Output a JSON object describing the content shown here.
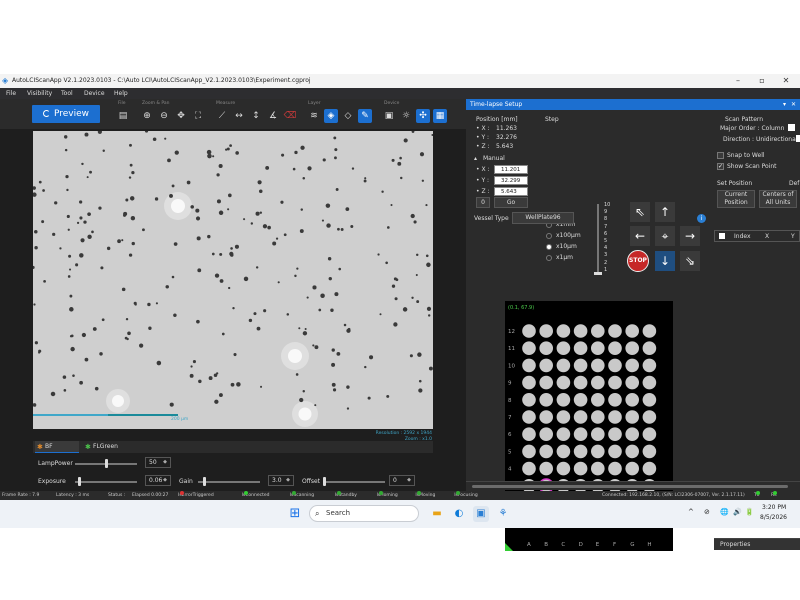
{
  "window": {
    "title": "AutoLCIScanApp V2.1.2023.0103 - C:\\Auto LCI\\AutoLCIScanApp_V2.1.2023.0103\\Experiment.cgproj",
    "minimize": "–",
    "maximize": "▫",
    "close": "✕"
  },
  "menu": [
    "File",
    "Visibility",
    "Tool",
    "Device",
    "Help"
  ],
  "toolbar": {
    "preview_label": "Preview",
    "groups": [
      "File",
      "Zoom & Pan",
      "Measure",
      "Layer",
      "Device"
    ]
  },
  "viewer": {
    "resolution": "Resolution : 2592 x 1944",
    "zoom": "Zoom : x1.0",
    "scalebar": "200 µm"
  },
  "channels": [
    {
      "label": "BF",
      "color": "#e08a2b",
      "selected": true
    },
    {
      "label": "FLGreen",
      "color": "#4cc24c",
      "selected": false
    }
  ],
  "controls": {
    "lamp_power": {
      "label": "LampPower",
      "value": "50"
    },
    "exposure": {
      "label": "Exposure",
      "value": "0.06"
    },
    "gain": {
      "label": "Gain",
      "value": "3.0"
    },
    "offset": {
      "label": "Offset",
      "value": "0"
    }
  },
  "panel": {
    "title": "Time-lapse Setup",
    "pin": "▾",
    "close": "✕",
    "position": {
      "heading": "Position [mm]",
      "x_label": "• X :",
      "x": "11.263",
      "y_label": "• Y :",
      "y": "32.276",
      "z_label": "• Z :",
      "z": "5.643",
      "manual_label": "Manual",
      "mx": "11.201",
      "my": "32.299",
      "mz": "5.643",
      "zero_label": "0",
      "go_label": "Go"
    },
    "step": {
      "heading": "Step",
      "options": [
        "x1mm",
        "x100µm",
        "x10µm",
        "x1µm"
      ],
      "selected": "x10µm",
      "scale": [
        "10",
        "9",
        "8",
        "7",
        "6",
        "5",
        "4",
        "3",
        "2",
        "1"
      ],
      "scale_level": 0.0
    },
    "stop_label": "STOP",
    "scan_pattern": {
      "heading": "Scan Pattern",
      "major_order": "Major Order : Column",
      "direction": "Direction : Unidirectional"
    },
    "snap_to_well": "Snap to Well",
    "show_scan_point": "Show Scan Point",
    "set_position": "Set Position",
    "def_label": "Def",
    "current_position": [
      "Current",
      "Position"
    ],
    "centers_all_units": [
      "Centers of",
      "All Units"
    ],
    "index_header": [
      "Index",
      "X",
      "Y"
    ],
    "vessel_type_label": "Vessel Type",
    "vessel_type": "WellPlate96",
    "coord_readout": "(0.1, 67.9)",
    "rows": [
      "12",
      "11",
      "10",
      "9",
      "8",
      "7",
      "6",
      "5",
      "4",
      "3",
      "2",
      "1"
    ],
    "cols": [
      "A",
      "B",
      "C",
      "D",
      "E",
      "F",
      "G",
      "H"
    ],
    "selected_well": {
      "row": "3",
      "col": "B"
    },
    "properties": "Properties"
  },
  "status": {
    "frame_rate": "Frame Rate : 7.9",
    "latency": "Latency : 3 ms",
    "status": "Status :",
    "elapsed": "Elapsed 0.00:27",
    "flags": [
      {
        "label": "IsErrorTriggered",
        "color": "#d33"
      },
      {
        "label": "IsConnected",
        "color": "#3c3"
      },
      {
        "label": "IsScanning",
        "color": "#3a3"
      },
      {
        "label": "IsStandby",
        "color": "#3a3"
      },
      {
        "label": "IsHoming",
        "color": "#3a3"
      },
      {
        "label": "IsMoving",
        "color": "#3a3"
      },
      {
        "label": "IsFocusing",
        "color": "#3a3"
      }
    ],
    "connected": "Connected: 192.168.2.10, (S/N: LCI2306-07007, Ver. 2.1.17.11)",
    "tx": "Tx",
    "rx": "Rx"
  },
  "taskbar": {
    "search": "Search",
    "time": "3:20 PM",
    "date": "8/5/2026",
    "tray": [
      "^",
      "⊘",
      "🌐",
      "🔊",
      "🔋"
    ]
  }
}
